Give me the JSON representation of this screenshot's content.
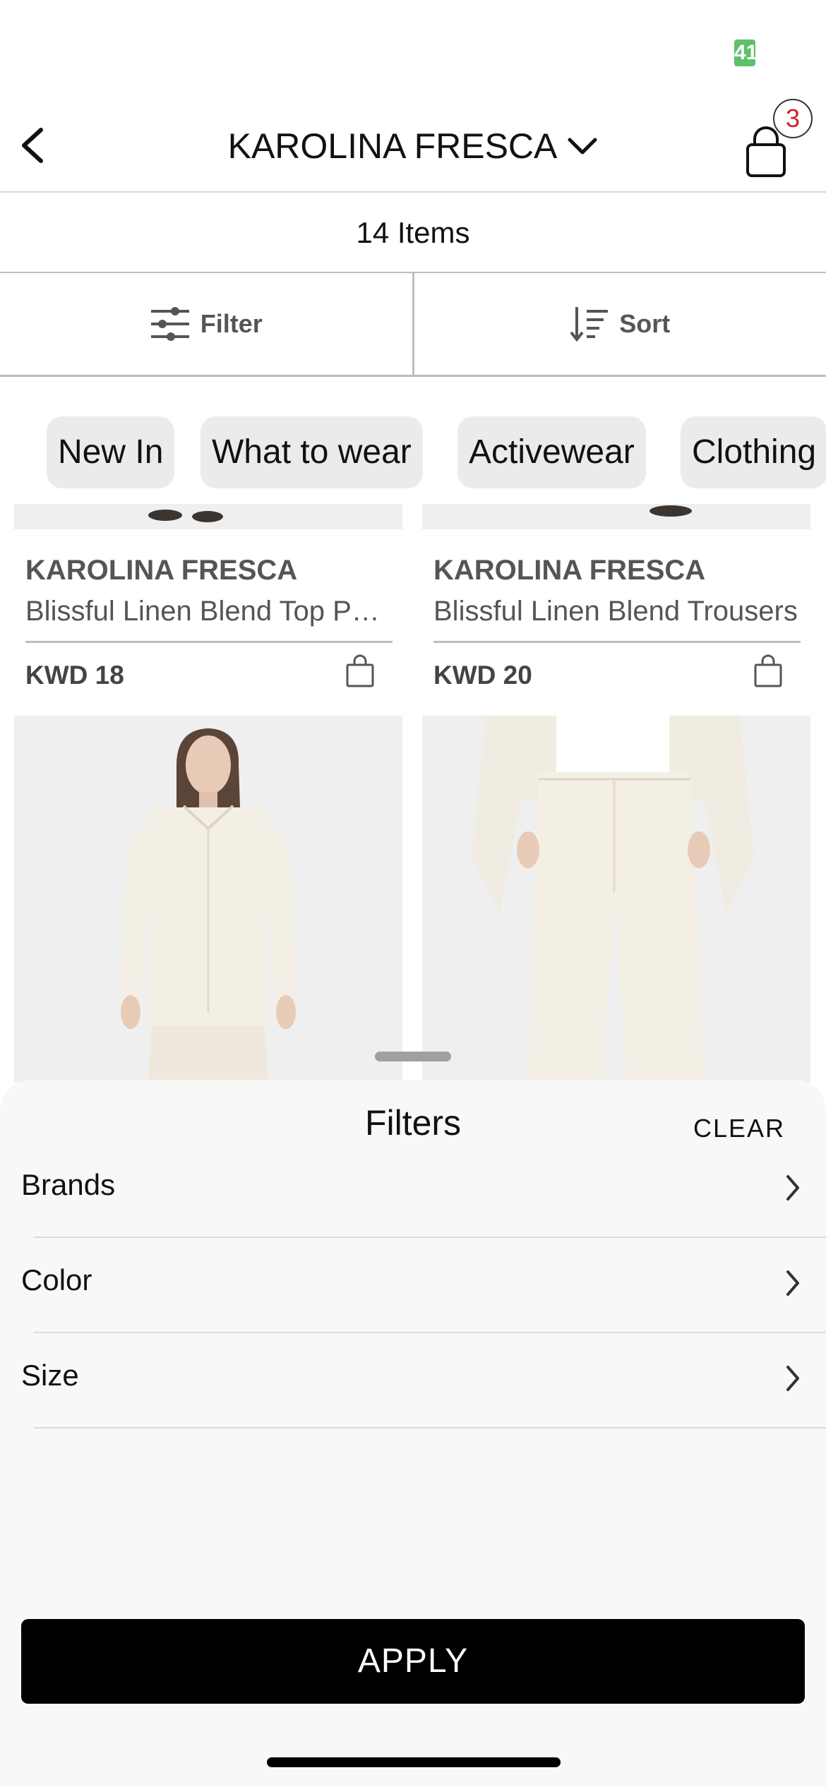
{
  "status_bar": {
    "battery": "41"
  },
  "header": {
    "title": "KAROLINA FRESCA",
    "cart_count": "3"
  },
  "items_count": "14 Items",
  "toolbar": {
    "filter_label": "Filter",
    "sort_label": "Sort"
  },
  "chips": [
    "New In",
    "What to wear",
    "Activewear",
    "Clothing"
  ],
  "products": [
    {
      "brand": "KAROLINA FRESCA",
      "name": "Blissful Linen Blend Top Pants Set",
      "price": "KWD 18"
    },
    {
      "brand": "KAROLINA FRESCA",
      "name": "Blissful Linen Blend Trousers",
      "price": "KWD 20"
    }
  ],
  "sheet": {
    "title": "Filters",
    "clear_label": "CLEAR",
    "rows": [
      "Brands",
      "Color",
      "Size"
    ],
    "apply_label": "APPLY"
  },
  "colors": {
    "accent_black": "#000000",
    "badge_red": "#d0202a",
    "battery_green": "#5cc16a"
  }
}
